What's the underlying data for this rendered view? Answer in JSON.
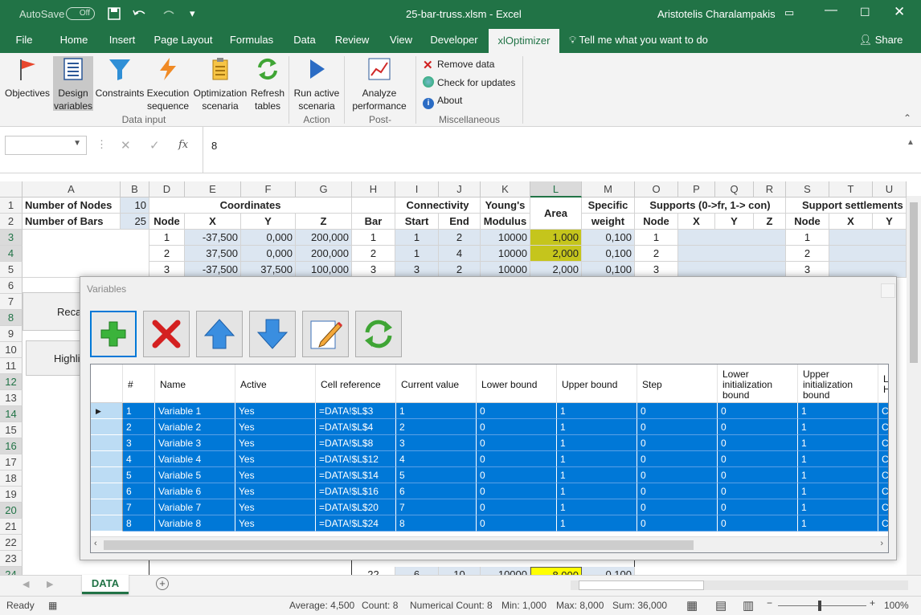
{
  "titlebar": {
    "autosave_label": "AutoSave",
    "autosave_state": "Off",
    "file_title": "25-bar-truss.xlsm  -  Excel",
    "user": "Aristotelis Charalampakis"
  },
  "ribbon_tabs": [
    "File",
    "Home",
    "Insert",
    "Page Layout",
    "Formulas",
    "Data",
    "Review",
    "View",
    "Developer",
    "xlOptimizer",
    "Tell me what you want to do",
    "Share"
  ],
  "ribbon": {
    "data_input": {
      "group_label": "Data input",
      "buttons": [
        "Objectives",
        "Design\nvariables",
        "Constraints",
        "Execution\nsequence",
        "Optimization\nscenaria",
        "Refresh\ntables"
      ]
    },
    "action": {
      "group_label": "Action",
      "buttons": [
        "Run active\nscenaria"
      ]
    },
    "post": {
      "group_label": "Post-processing",
      "buttons": [
        "Analyze\nperformance"
      ]
    },
    "misc": {
      "group_label": "Miscellaneous",
      "buttons": [
        "Remove data",
        "Check for updates",
        "About"
      ]
    }
  },
  "formula_bar": {
    "name_box": "",
    "fx": "fx",
    "value": "8"
  },
  "sheet": {
    "columns": [
      "A",
      "B",
      "D",
      "E",
      "F",
      "G",
      "H",
      "I",
      "J",
      "K",
      "L",
      "M",
      "O",
      "P",
      "Q",
      "R",
      "S",
      "T",
      "U"
    ],
    "row_numbers": [
      "1",
      "2",
      "3",
      "4",
      "5",
      "6",
      "7",
      "8",
      "9",
      "10",
      "11",
      "12",
      "13",
      "14",
      "15",
      "16",
      "17",
      "18",
      "19",
      "20",
      "21",
      "22",
      "23",
      "24"
    ],
    "labels": {
      "nodes_label": "Number of Nodes",
      "nodes_value": "10",
      "bars_label": "Number of Bars",
      "bars_value": "25",
      "coordinates": "Coordinates",
      "connectivity": "Connectivity",
      "youngs": "Young's",
      "modulus": "Modulus",
      "area": "Area",
      "specific": "Specific",
      "weight": "weight",
      "supports": "Supports (0->fr, 1-> con)",
      "settlements": "Support settlements",
      "node": "Node",
      "x": "X",
      "y": "Y",
      "z": "Z",
      "bar": "Bar",
      "start": "Start",
      "end": "End"
    },
    "rows": [
      {
        "node": "1",
        "x": "-37,500",
        "y": "0,000",
        "z": "200,000",
        "bar": "1",
        "start": "1",
        "end": "2",
        "mod": "10000",
        "area": "1,000",
        "w": "0,100",
        "snode": "1",
        "setnode": "1"
      },
      {
        "node": "2",
        "x": "37,500",
        "y": "0,000",
        "z": "200,000",
        "bar": "2",
        "start": "1",
        "end": "4",
        "mod": "10000",
        "area": "2,000",
        "w": "0,100",
        "snode": "2",
        "setnode": "2"
      },
      {
        "node": "3",
        "x": "-37,500",
        "y": "37,500",
        "z": "100,000",
        "bar": "3",
        "start": "3",
        "end": "2",
        "mod": "10000",
        "area": "2,000",
        "w": "0,100",
        "snode": "3",
        "setnode": "3"
      }
    ],
    "row24": {
      "bar": "22",
      "start": "6",
      "end": "10",
      "mod": "10000",
      "area": "8,000",
      "w": "0,100"
    },
    "recalc_button": "Recal",
    "highlight_button": "Highli"
  },
  "dialog": {
    "title": "Variables",
    "toolbar": [
      "add-icon",
      "delete-icon",
      "move-up-icon",
      "move-down-icon",
      "edit-icon",
      "refresh-icon"
    ],
    "headers": [
      "#",
      "Name",
      "Active",
      "Cell reference",
      "Current value",
      "Lower bound",
      "Upper bound",
      "Step",
      "Lower initialization bound",
      "Upper initialization bound",
      "L H"
    ],
    "rows": [
      [
        "1",
        "Variable 1",
        "Yes",
        "=DATA!$L$3",
        "1",
        "0",
        "1",
        "0",
        "0",
        "1",
        "Cl"
      ],
      [
        "2",
        "Variable 2",
        "Yes",
        "=DATA!$L$4",
        "2",
        "0",
        "1",
        "0",
        "0",
        "1",
        "Cl"
      ],
      [
        "3",
        "Variable 3",
        "Yes",
        "=DATA!$L$8",
        "3",
        "0",
        "1",
        "0",
        "0",
        "1",
        "Cl"
      ],
      [
        "4",
        "Variable 4",
        "Yes",
        "=DATA!$L$12",
        "4",
        "0",
        "1",
        "0",
        "0",
        "1",
        "Cl"
      ],
      [
        "5",
        "Variable 5",
        "Yes",
        "=DATA!$L$14",
        "5",
        "0",
        "1",
        "0",
        "0",
        "1",
        "Cl"
      ],
      [
        "6",
        "Variable 6",
        "Yes",
        "=DATA!$L$16",
        "6",
        "0",
        "1",
        "0",
        "0",
        "1",
        "Cl"
      ],
      [
        "7",
        "Variable 7",
        "Yes",
        "=DATA!$L$20",
        "7",
        "0",
        "1",
        "0",
        "0",
        "1",
        "Cl"
      ],
      [
        "8",
        "Variable 8",
        "Yes",
        "=DATA!$L$24",
        "8",
        "0",
        "1",
        "0",
        "0",
        "1",
        "Cl"
      ]
    ]
  },
  "sheet_tab": "DATA",
  "status": {
    "ready": "Ready",
    "average": "Average: 4,500",
    "count": "Count: 8",
    "numcount": "Numerical Count: 8",
    "min": "Min: 1,000",
    "max": "Max: 8,000",
    "sum": "Sum: 36,000",
    "zoom": "100%"
  },
  "colors": {
    "excel_green": "#217346",
    "selection_blue": "#0078d7",
    "olive": "#c5c51c"
  }
}
